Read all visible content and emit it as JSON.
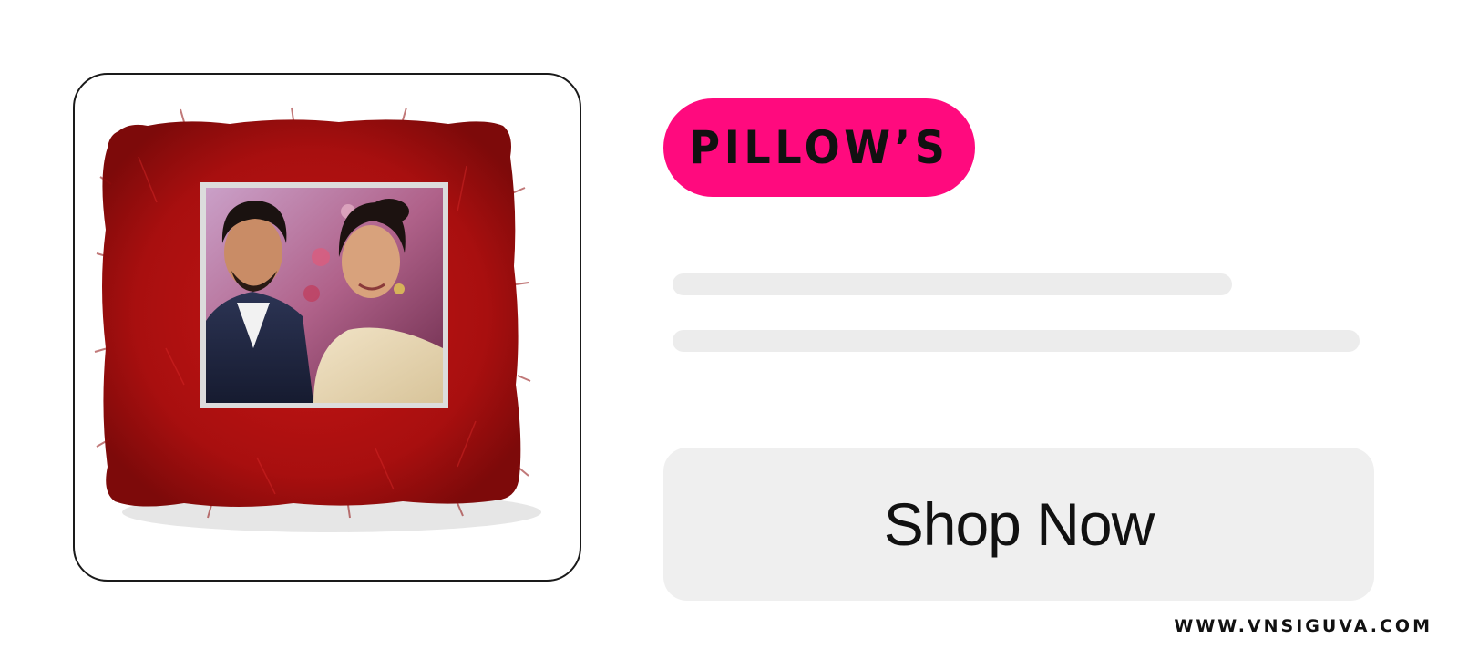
{
  "product_card": {
    "image_alt": "Red fur photo pillow",
    "colors": {
      "fur": "#b51212",
      "fur_dark": "#7d0a0a",
      "photo_border": "#dcdcdc"
    }
  },
  "category": {
    "label": "PILLOW’S",
    "color": "#ff0a7e"
  },
  "description_placeholder": {
    "lines": 2,
    "color": "#ececec"
  },
  "cta": {
    "label": "Shop Now",
    "color": "#efefef"
  },
  "watermark": {
    "text": "WWW.VNSIGUVA.COM"
  }
}
